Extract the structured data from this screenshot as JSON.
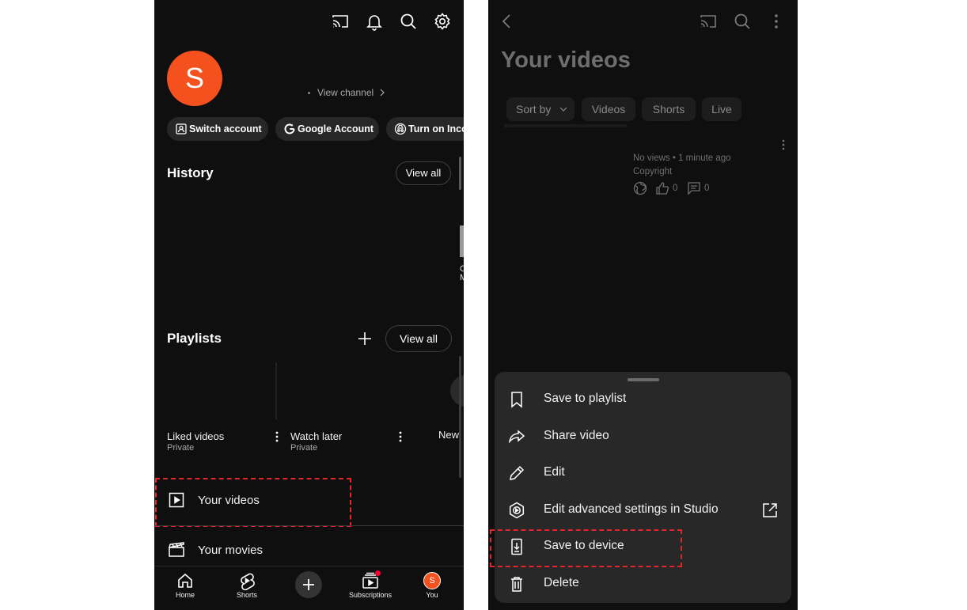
{
  "left": {
    "avatar_letter": "S",
    "view_channel": "View channel",
    "pills": [
      {
        "label": "Switch account",
        "icon": "switch-account-icon"
      },
      {
        "label": "Google Account",
        "icon": "google-g-icon"
      },
      {
        "label": "Turn on Inco",
        "icon": "incognito-icon"
      }
    ],
    "history": {
      "title": "History",
      "view_all": "View all"
    },
    "playlists": {
      "title": "Playlists",
      "view_all": "View all",
      "items": [
        {
          "title": "Liked videos",
          "sub": "Private"
        },
        {
          "title": "Watch later",
          "sub": "Private"
        },
        {
          "title": "New",
          "sub": ""
        }
      ]
    },
    "history_peek": "C\nM",
    "menu": [
      {
        "label": "Your videos",
        "icon": "play-square-icon"
      },
      {
        "label": "Your movies",
        "icon": "clapperboard-icon"
      }
    ],
    "bottom_nav": [
      {
        "label": "Home",
        "icon": "home-icon"
      },
      {
        "label": "Shorts",
        "icon": "shorts-icon"
      },
      {
        "label": "",
        "icon": "create-plus-icon"
      },
      {
        "label": "Subscriptions",
        "icon": "subscriptions-icon"
      },
      {
        "label": "You",
        "icon": "avatar-icon"
      }
    ],
    "bottom_avatar_letter": "S"
  },
  "right": {
    "page_title": "Your videos",
    "chips": [
      "Sort by",
      "Videos",
      "Shorts",
      "Live"
    ],
    "video": {
      "meta": "No views • 1 minute ago",
      "status": "Copyright",
      "likes": "0",
      "comments": "0"
    },
    "sheet": [
      {
        "label": "Save to playlist",
        "icon": "bookmark-icon"
      },
      {
        "label": "Share video",
        "icon": "share-icon"
      },
      {
        "label": "Edit",
        "icon": "pencil-icon"
      },
      {
        "label": "Edit advanced settings in Studio",
        "icon": "studio-hexagon-icon"
      },
      {
        "label": "Save to device",
        "icon": "download-phone-icon"
      },
      {
        "label": "Delete",
        "icon": "trash-icon"
      }
    ]
  },
  "colors": {
    "background": "#0f0f0f",
    "avatar": "#f4511e",
    "highlight": "#e0262b",
    "sheet": "#282828"
  }
}
